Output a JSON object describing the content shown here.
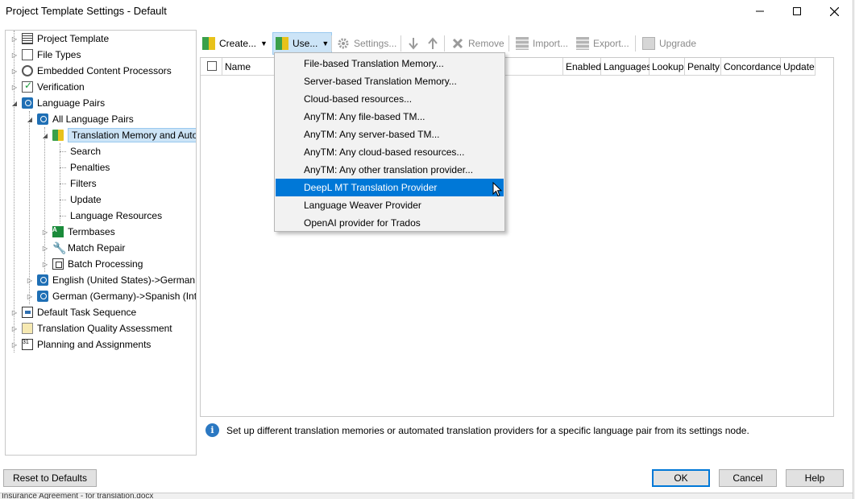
{
  "window": {
    "title": "Project Template Settings - Default"
  },
  "tree": {
    "items": [
      {
        "label": "Project Template"
      },
      {
        "label": "File Types"
      },
      {
        "label": "Embedded Content Processors"
      },
      {
        "label": "Verification"
      },
      {
        "label": "Language Pairs"
      },
      {
        "label": "All Language Pairs"
      },
      {
        "label": "Translation Memory and Auto"
      },
      {
        "label": "Search"
      },
      {
        "label": "Penalties"
      },
      {
        "label": "Filters"
      },
      {
        "label": "Update"
      },
      {
        "label": "Language Resources"
      },
      {
        "label": "Termbases"
      },
      {
        "label": "Match Repair"
      },
      {
        "label": "Batch Processing"
      },
      {
        "label": "English (United States)->German ("
      },
      {
        "label": "German (Germany)->Spanish (Inte"
      },
      {
        "label": "Default Task Sequence"
      },
      {
        "label": "Translation Quality Assessment"
      },
      {
        "label": "Planning and Assignments"
      }
    ]
  },
  "toolbar": {
    "create": "Create...",
    "use": "Use...",
    "settings": "Settings...",
    "remove": "Remove",
    "import": "Import...",
    "export": "Export...",
    "upgrade": "Upgrade"
  },
  "grid": {
    "columns": [
      "Name",
      "Enabled",
      "Languages",
      "Lookup",
      "Penalty",
      "Concordance",
      "Update"
    ]
  },
  "use_menu": {
    "items": [
      "File-based Translation Memory...",
      "Server-based Translation Memory...",
      "Cloud-based resources...",
      "AnyTM: Any file-based TM...",
      "AnyTM: Any server-based TM...",
      "AnyTM: Any cloud-based resources...",
      "AnyTM: Any other translation provider...",
      "DeepL MT Translation Provider",
      "Language Weaver Provider",
      "OpenAI provider for Trados"
    ],
    "highlighted": "DeepL MT Translation Provider"
  },
  "info": {
    "text": "Set up different translation memories or automated translation providers for a specific language pair from its settings node."
  },
  "buttons": {
    "reset": "Reset to Defaults",
    "ok": "OK",
    "cancel": "Cancel",
    "help": "Help"
  },
  "background": {
    "file_label": "Insurance Agreement - for translation.docx"
  },
  "colors": {
    "selection": "#0078d7",
    "accent": "#2b78c2"
  }
}
